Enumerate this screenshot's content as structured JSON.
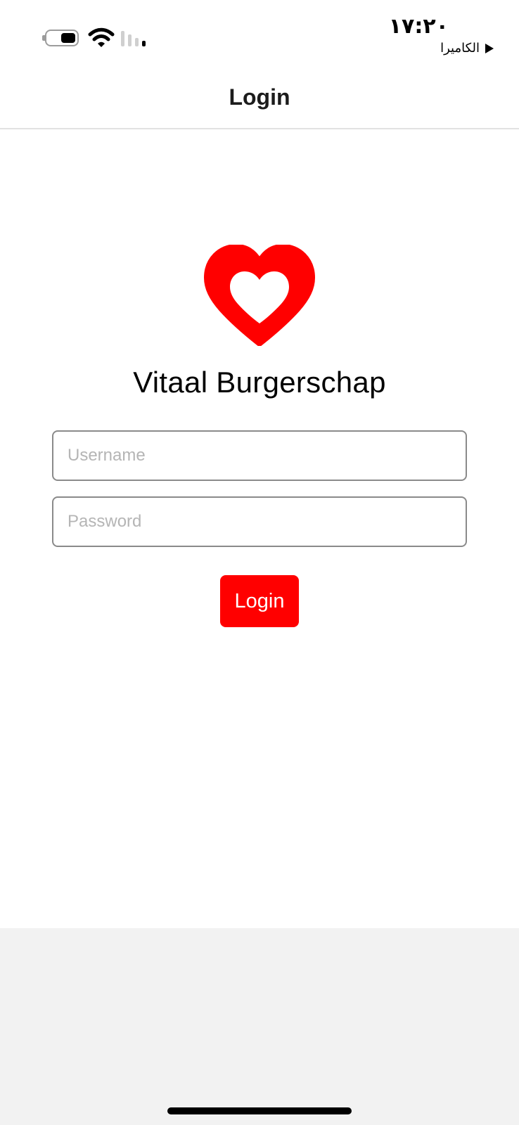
{
  "status_bar": {
    "time": "١٧:٢٠",
    "camera_label": "الكاميرا"
  },
  "nav": {
    "title": "Login"
  },
  "app": {
    "title": "Vitaal Burgerschap",
    "brand_color": "#ff0000"
  },
  "form": {
    "username": {
      "value": "",
      "placeholder": "Username"
    },
    "password": {
      "value": "",
      "placeholder": "Password"
    },
    "login_label": "Login"
  },
  "icons": {
    "logo": "heart-icon",
    "battery": "battery-icon",
    "wifi": "wifi-icon",
    "signal": "cellular-signal-icon",
    "camera": "play-icon"
  }
}
